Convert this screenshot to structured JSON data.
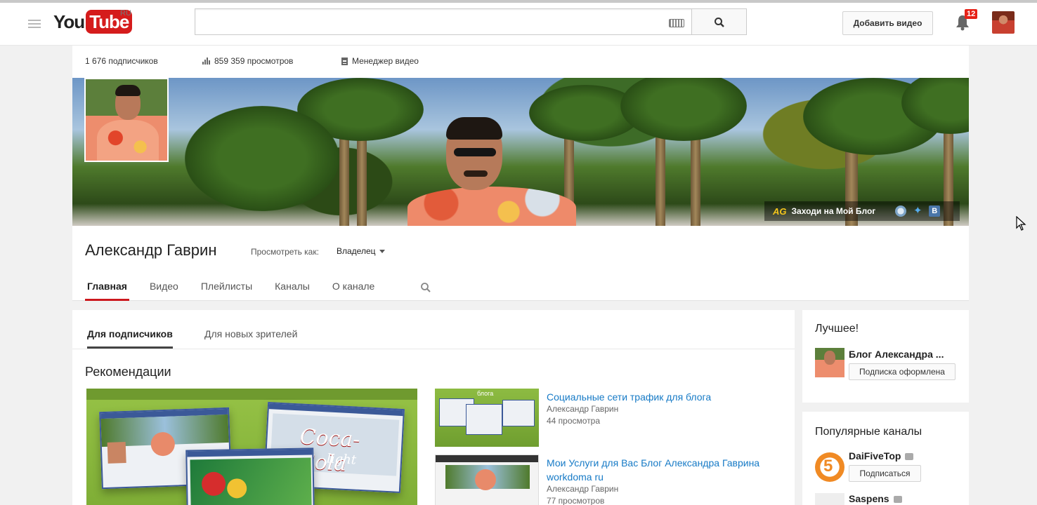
{
  "masthead": {
    "logo_you": "You",
    "logo_tube": "Tube",
    "region": "RU",
    "search_placeholder": "",
    "upload_label": "Добавить видео",
    "notification_count": "12"
  },
  "channel": {
    "stats": {
      "subscribers": "1 676 подписчиков",
      "views": "859 359 просмотров",
      "video_manager": "Менеджер видео"
    },
    "banner_link": {
      "logo": "AG",
      "text": "Заходи на Мой Блог"
    },
    "name": "Александр Гаврин",
    "view_as_label": "Просмотреть как:",
    "view_as_value": "Владелец",
    "tabs": [
      "Главная",
      "Видео",
      "Плейлисты",
      "Каналы",
      "О канале"
    ]
  },
  "main": {
    "subtabs": [
      "Для подписчиков",
      "Для новых зрителей"
    ],
    "section_title": "Рекомендации",
    "featured_thumb": {
      "logo": "Coca-Cola",
      "sub": "light"
    },
    "side_videos": [
      {
        "title": "Социальные сети трафик для блога",
        "author": "Александр Гаврин",
        "views": "44 просмотра",
        "thumb_caption": "блога"
      },
      {
        "title": "Мои Услуги для Вас Блог Александра Гаврина workdoma ru",
        "author": "Александр Гаврин",
        "views": "77 просмотров"
      }
    ]
  },
  "sidebar": {
    "best_title": "Лучшее!",
    "best_channel": "Блог Александра ...",
    "best_button": "Подписка оформлена",
    "popular_title": "Популярные каналы",
    "popular": [
      {
        "name": "DaiFiveTop",
        "button": "Подписаться"
      },
      {
        "name": "Saspens"
      }
    ]
  },
  "colors": {
    "accent_red": "#cc181e",
    "link_blue": "#167ac6",
    "badge_red": "#e62117"
  }
}
